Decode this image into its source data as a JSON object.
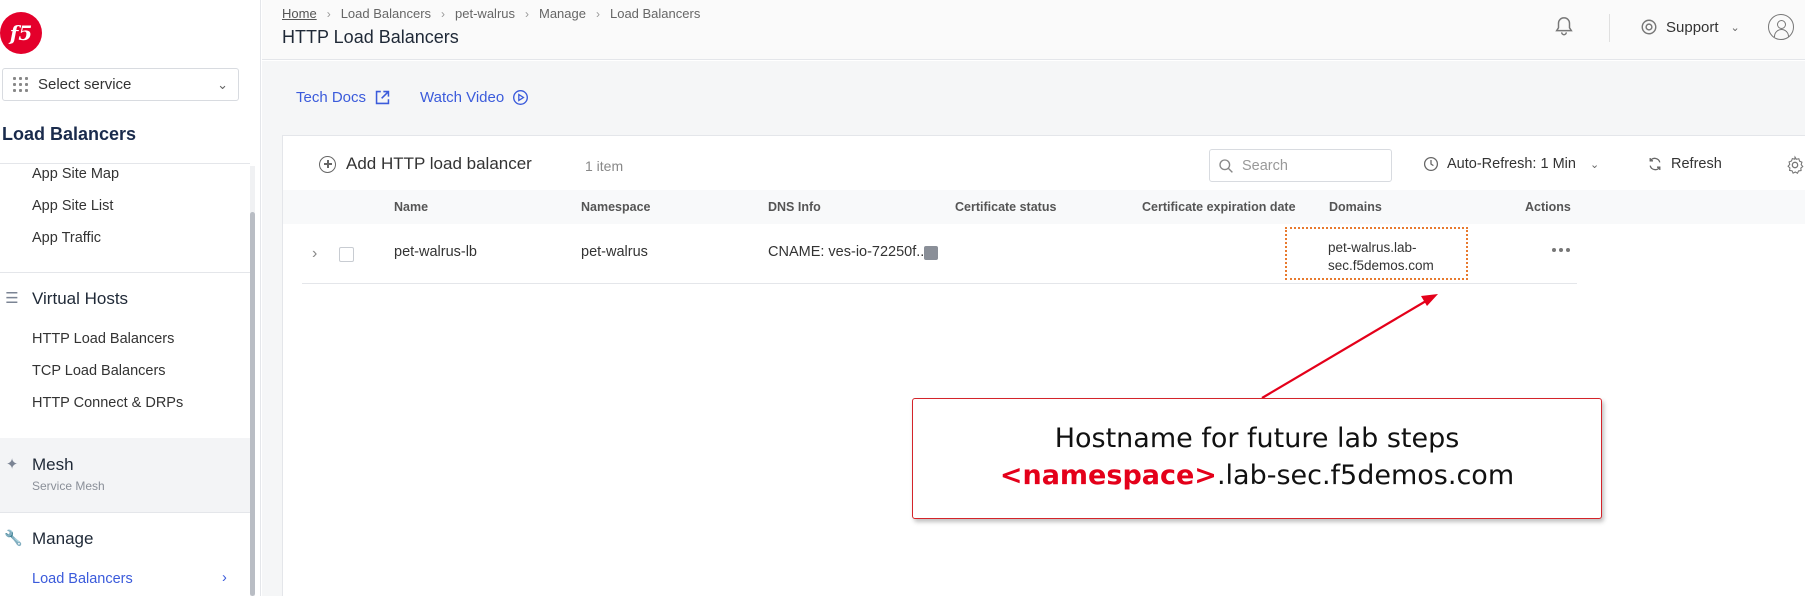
{
  "sidebar": {
    "logo_text": "f5",
    "select_service_label": "Select service",
    "section_title": "Load Balancers",
    "items_top": [
      {
        "label": "App Site Map"
      },
      {
        "label": "App Site List"
      },
      {
        "label": "App Traffic"
      }
    ],
    "virtual_hosts": {
      "title": "Virtual Hosts",
      "items": [
        {
          "label": "HTTP Load Balancers"
        },
        {
          "label": "TCP Load Balancers"
        },
        {
          "label": "HTTP Connect & DRPs"
        }
      ]
    },
    "mesh": {
      "title": "Mesh",
      "subtitle": "Service Mesh"
    },
    "manage": {
      "title": "Manage",
      "items": [
        {
          "label": "Load Balancers"
        }
      ]
    }
  },
  "header": {
    "breadcrumbs": [
      "Home",
      "Load Balancers",
      "pet-walrus",
      "Manage",
      "Load Balancers"
    ],
    "title": "HTTP Load Balancers",
    "support_label": "Support"
  },
  "links": {
    "tech_docs": "Tech Docs",
    "watch_video": "Watch Video"
  },
  "toolbar": {
    "add_label": "Add HTTP load balancer",
    "item_count": "1 item",
    "search_placeholder": "Search",
    "auto_refresh_label": "Auto-Refresh: 1 Min",
    "refresh_label": "Refresh"
  },
  "table": {
    "columns": [
      "Name",
      "Namespace",
      "DNS Info",
      "Certificate status",
      "Certificate expiration date",
      "Domains",
      "Actions"
    ],
    "rows": [
      {
        "name": "pet-walrus-lb",
        "namespace": "pet-walrus",
        "dns_info": "CNAME: ves-io-72250f...",
        "certificate_status": "",
        "certificate_expiration": "",
        "domains_line1": "pet-walrus.lab-",
        "domains_line2": "sec.f5demos.com"
      }
    ]
  },
  "annotation": {
    "line1": "Hostname for future lab steps",
    "namespace_token": "<namespace>",
    "domain_suffix": ".lab-sec.f5demos.com",
    "color": "#d4242a"
  }
}
